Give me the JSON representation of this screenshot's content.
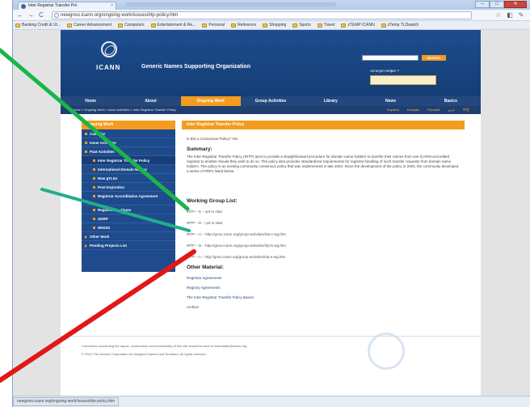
{
  "browser": {
    "tab_title": "Inter Registrar Transfer Pol",
    "tab_close": "×",
    "url": "newgnso.icann.org/ongoing-work/issues/irtp-policy.htm",
    "controls": {
      "minimize": "–",
      "maximize": "□",
      "close": "✕"
    },
    "nav": {
      "back": "←",
      "forward": "→",
      "reload": "C"
    },
    "bookmarks": [
      "Banking Credit & Ut...",
      "Career Advancement",
      "Computers",
      "Entertainment & Re...",
      "Personal",
      "Reference",
      "Shopping",
      "Sports",
      "Travel",
      "zTEMP ICANN",
      "zTemp TLDwatch"
    ],
    "status_url": "newgnso.icann.org/ongoing-work/issues/irtp-policy.htm"
  },
  "site": {
    "logo_text": "ICANN",
    "title": "Generic Names Supporting Organization",
    "search_button": "SEARCH",
    "acronym_helper": "Acronym Helper",
    "nav": [
      "Home",
      "About",
      "Ongoing Work",
      "Group Activities",
      "Library",
      "News",
      "Basics"
    ],
    "breadcrumb": "Home » Ongoing Work » Issue Activities » Inter Registrar Transfer Policy",
    "languages": [
      "Español",
      "Français",
      "Русский",
      "عربي",
      "中文"
    ]
  },
  "sidebar": {
    "heading": "Ongoing Work",
    "items": [
      "Calendar",
      "Issue Activities",
      "Past Activities",
      "Inter Registrar Transfer Policy",
      "International Domain Names",
      "New gTLDs",
      "Post Expiration",
      "Registrar Accreditation Agreement",
      "Registration Abuse",
      "UDRP",
      "WHOIS",
      "Other Work",
      "Pending Projects List"
    ]
  },
  "content": {
    "heading": "Inter Registrar Transfer Policy",
    "question": "Is this a Consensus Policy? Yes",
    "summary_heading": "Summary:",
    "summary_text": "The Inter-Registrar Transfer Policy (IRTP) aims to provide a straightforward procedure for domain name holders to transfer their names from one ICANN-accredited registrar to another should they wish to do so. The policy also provides standardized requirements for registrar handling of such transfer requests from domain name holders. The policy is an existing community consensus policy that was implemented in late 2004. Since the development of the policy in 2004, the community developed a series of PDPs listed below.",
    "working_group_heading": "Working Group List:",
    "pdps": [
      "IRTP – E – yet to start",
      "IRTP – D – yet to start",
      "IRTP – C – http://gnso.icann.org/group-activities/irtp-c-wg.htm",
      "IRTP – B – http://gnso.icann.org/group-activities/irtp-b-wg.htm",
      "IRTP – A – http://gnso.icann.org/group-activities/irtp-a-wg.htm"
    ],
    "other_heading": "Other Material:",
    "other_links": [
      "Registrar Agreements",
      "Registry Agreements",
      "The Inter-Registrar Transfer Policy Basics",
      "Archive"
    ]
  },
  "footer": {
    "comments": "Comments concerning the layout, construction and functionality of this site should be sent to webmaster@icann.org.",
    "copyright": "© 2012 The Internet Corporation for Assigned Names and Numbers. All rights reserved."
  },
  "annotations": {
    "green": "#19b44a",
    "teal": "#1fae8c",
    "red": "#e01818"
  }
}
